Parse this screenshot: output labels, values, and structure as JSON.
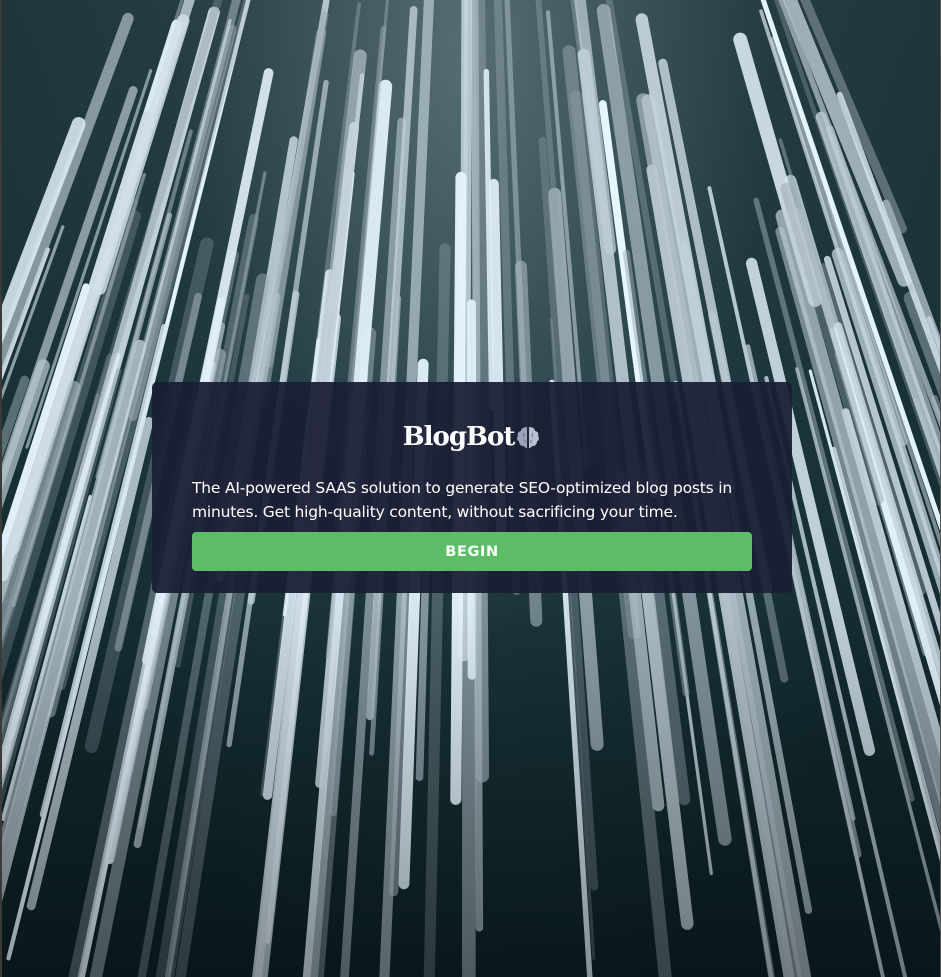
{
  "brand": {
    "name": "BlogBot",
    "icon": "brain-icon"
  },
  "hero": {
    "tagline": "The AI-powered SAAS solution to generate SEO-optimized blog posts in minutes. Get high-quality content, without sacrificing your time.",
    "begin_label": "BEGIN"
  },
  "colors": {
    "card_background": "#1b1e34",
    "button_background": "#5cbd66",
    "text": "#ffffff"
  }
}
